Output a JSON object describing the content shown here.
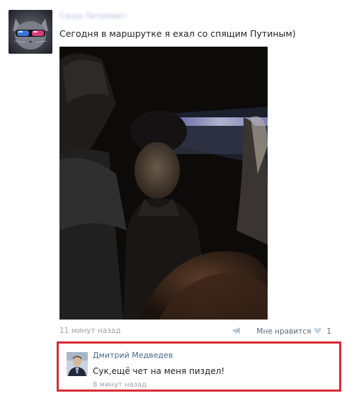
{
  "post": {
    "author": "Саша Петрович",
    "text": "Сегодня в маршрутке я ехал со спящим Путиным)",
    "time": "11 минут назад",
    "like_label": "Мне нравится",
    "like_count": "1"
  },
  "reply": {
    "author": "Дмитрий Медведев",
    "text": "Сук,ещё чет на меня пиздел!",
    "time": "8 минут назад"
  },
  "colors": {
    "link": "#45688e",
    "highlight_border": "#d82a37",
    "meta_gray": "#9aa3ad"
  },
  "icons": {
    "share": "megaphone-icon",
    "like": "heart-icon"
  }
}
